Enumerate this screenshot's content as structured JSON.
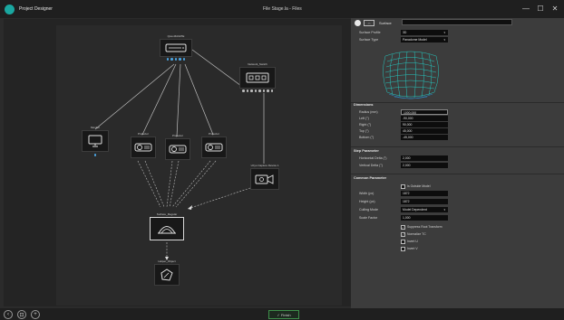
{
  "window": {
    "app_title": "Project Designer",
    "center_title": "File Stage.la - Files",
    "minimize": "—",
    "maximize": "☐",
    "close": "✕"
  },
  "nodes": {
    "main_switch": {
      "label": "Qsw-MAGPIE"
    },
    "network_switch": {
      "label": "Network_Switch"
    },
    "monitor": {
      "label": "Monitor"
    },
    "projector_1": {
      "label": "Projector"
    },
    "projector_2": {
      "label": "Projector"
    },
    "projector_3": {
      "label": "Projector"
    },
    "capture_device": {
      "label": "vOyo Capture Device 1"
    },
    "surface_regular": {
      "label": "Surface_Regular"
    },
    "helper_object": {
      "label": "Helper_Object"
    }
  },
  "bottom": {
    "btn_prev": "‹",
    "btn_frame": "⊡",
    "btn_add": "+",
    "finish_label": "✓ Finish"
  },
  "props": {
    "header": {
      "badge": "▭",
      "type_label": "Surface",
      "name_value": ""
    },
    "surface_profile": {
      "label": "Surface Profile",
      "value": "3D"
    },
    "surface_type": {
      "label": "Surface Type",
      "value": "Panadome Model"
    },
    "dimensions": {
      "title": "Dimensions",
      "radius": {
        "label": "Radius (mm)",
        "value": "1000,000"
      },
      "left": {
        "label": "Left (°)",
        "value": "-90,000"
      },
      "right": {
        "label": "Right (°)",
        "value": "90,000"
      },
      "top": {
        "label": "Top (°)",
        "value": "45,000"
      },
      "bottom": {
        "label": "Bottom (°)",
        "value": "-45,000"
      }
    },
    "step": {
      "title": "Step Parameter",
      "horizontal": {
        "label": "Horizontal Delta (°)",
        "value": "2,000"
      },
      "vertical": {
        "label": "Vertical Delta (°)",
        "value": "2,000"
      }
    },
    "common": {
      "title": "Common Parameter",
      "is_outside": {
        "label": "Is Outside Model",
        "checked": false
      },
      "width": {
        "label": "Width (px)",
        "value": "1872"
      },
      "height": {
        "label": "Height (px)",
        "value": "1872"
      },
      "culling": {
        "label": "Culling Mode",
        "value": "Model Dependent"
      },
      "scale": {
        "label": "Scale Factor",
        "value": "1,000"
      },
      "suppress": {
        "label": "Suppress Root Transform",
        "checked": true
      },
      "normalize": {
        "label": "Normalize TC",
        "checked": true
      },
      "invert_u": {
        "label": "Invert U",
        "checked": false
      },
      "invert_v": {
        "label": "Invert V",
        "checked": false
      }
    }
  },
  "colors": {
    "accent_green": "#3e8f4a",
    "link_port": "#4aa3e0",
    "preview_mesh": "#25c8c0"
  }
}
